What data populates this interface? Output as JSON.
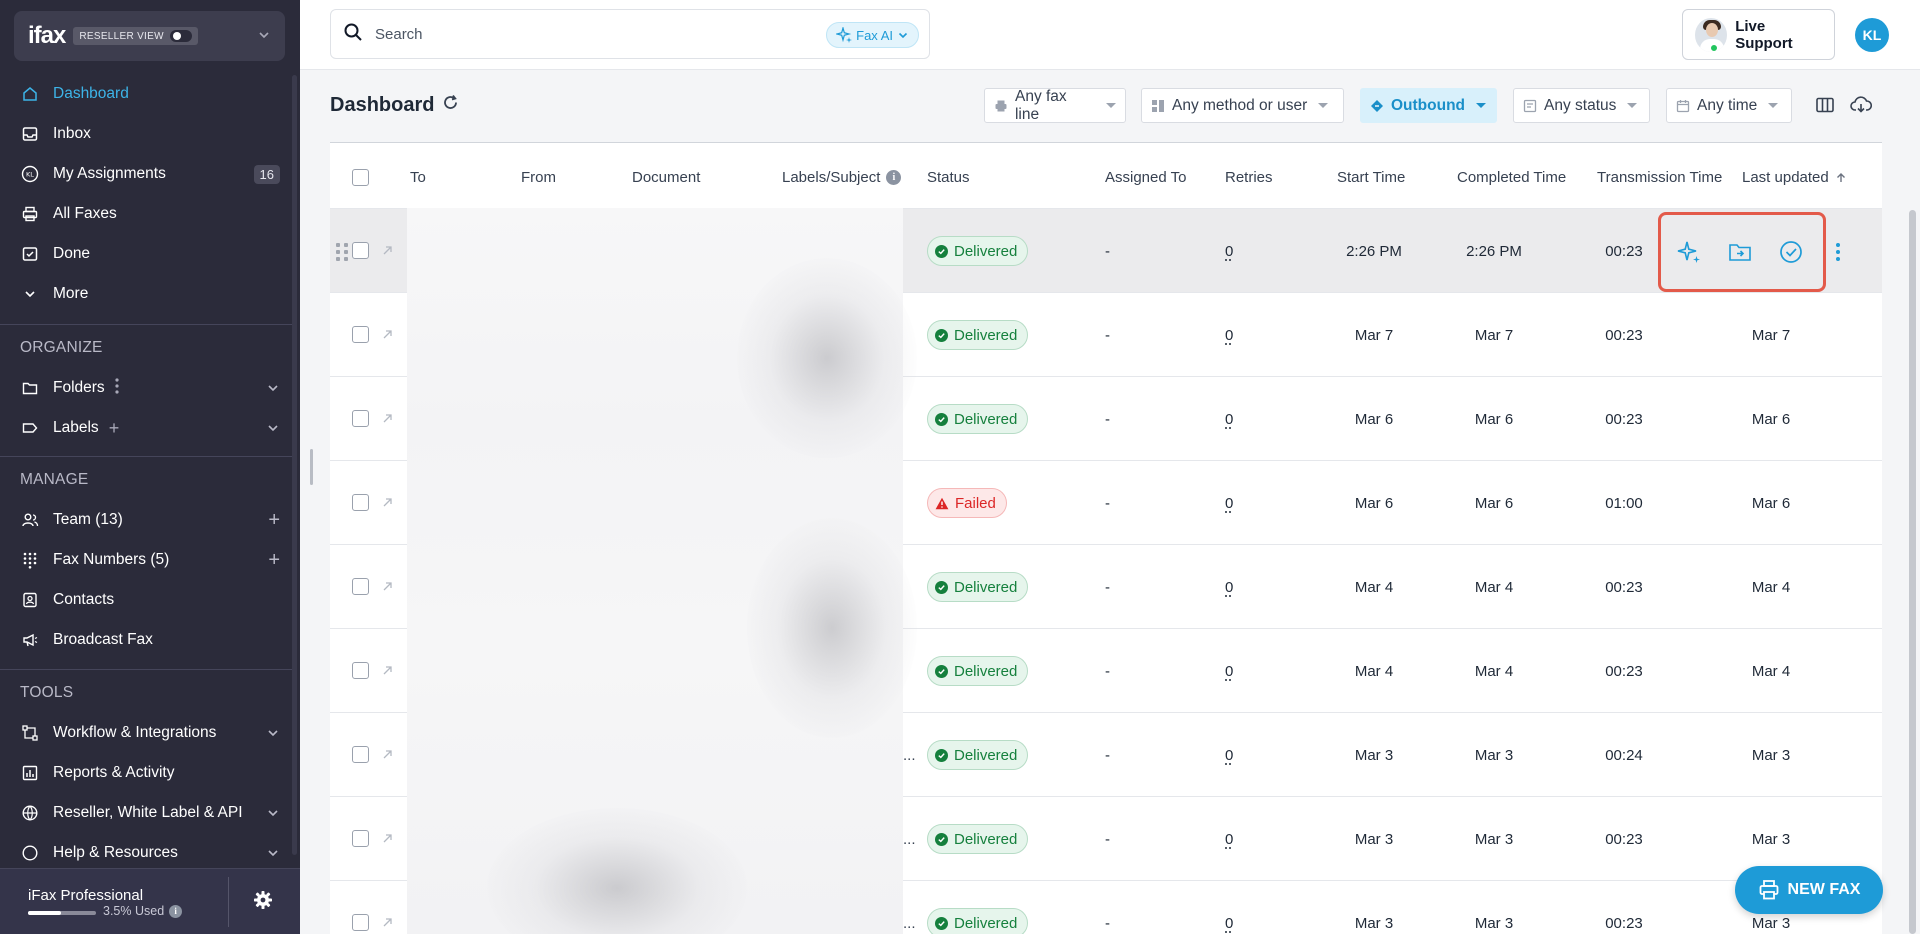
{
  "brand": {
    "logo": "ifax",
    "reseller_chip": "RESELLER VIEW"
  },
  "nav": {
    "dashboard": "Dashboard",
    "inbox": "Inbox",
    "my_assignments": "My Assignments",
    "my_assignments_count": "16",
    "all_faxes": "All Faxes",
    "done": "Done",
    "more": "More"
  },
  "organize": {
    "label": "ORGANIZE",
    "folders": "Folders",
    "labels": "Labels"
  },
  "manage": {
    "label": "MANAGE",
    "team": "Team (13)",
    "fax_numbers": "Fax Numbers (5)",
    "contacts": "Contacts",
    "broadcast": "Broadcast Fax"
  },
  "tools": {
    "label": "TOOLS",
    "workflow": "Workflow & Integrations",
    "reports": "Reports & Activity",
    "reseller": "Reseller, White Label & API",
    "help": "Help & Resources"
  },
  "plan": {
    "name": "iFax Professional",
    "used_label": "3.5% Used",
    "used_fraction": 0.035
  },
  "search": {
    "placeholder": "Search",
    "faxai_label": "Fax AI"
  },
  "live_support": {
    "label": "Live Support"
  },
  "user": {
    "initials": "KL"
  },
  "page": {
    "title": "Dashboard"
  },
  "filters": {
    "fax_line": "Any fax line",
    "method": "Any method or user",
    "direction": "Outbound",
    "status": "Any status",
    "time": "Any time"
  },
  "table": {
    "columns": {
      "to": "To",
      "from": "From",
      "document": "Document",
      "labels": "Labels/Subject",
      "status": "Status",
      "assigned": "Assigned To",
      "retries": "Retries",
      "start": "Start Time",
      "completed": "Completed Time",
      "transmission": "Transmission Time",
      "updated": "Last updated"
    },
    "rows": [
      {
        "truncated": "",
        "status": "Delivered",
        "assigned": "-",
        "retries": "0",
        "start": "2:26 PM",
        "completed": "2:26 PM",
        "transmission": "00:23",
        "updated": ""
      },
      {
        "truncated": "",
        "status": "Delivered",
        "assigned": "-",
        "retries": "0",
        "start": "Mar 7",
        "completed": "Mar 7",
        "transmission": "00:23",
        "updated": "Mar 7"
      },
      {
        "truncated": "",
        "status": "Delivered",
        "assigned": "-",
        "retries": "0",
        "start": "Mar 6",
        "completed": "Mar 6",
        "transmission": "00:23",
        "updated": "Mar 6"
      },
      {
        "truncated": "",
        "status": "Failed",
        "assigned": "-",
        "retries": "0",
        "start": "Mar 6",
        "completed": "Mar 6",
        "transmission": "01:00",
        "updated": "Mar 6"
      },
      {
        "truncated": "",
        "status": "Delivered",
        "assigned": "-",
        "retries": "0",
        "start": "Mar 4",
        "completed": "Mar 4",
        "transmission": "00:23",
        "updated": "Mar 4"
      },
      {
        "truncated": "",
        "status": "Delivered",
        "assigned": "-",
        "retries": "0",
        "start": "Mar 4",
        "completed": "Mar 4",
        "transmission": "00:23",
        "updated": "Mar 4"
      },
      {
        "truncated": "...",
        "status": "Delivered",
        "assigned": "-",
        "retries": "0",
        "start": "Mar 3",
        "completed": "Mar 3",
        "transmission": "00:24",
        "updated": "Mar 3"
      },
      {
        "truncated": "...",
        "status": "Delivered",
        "assigned": "-",
        "retries": "0",
        "start": "Mar 3",
        "completed": "Mar 3",
        "transmission": "00:23",
        "updated": "Mar 3"
      },
      {
        "truncated": "...",
        "status": "Delivered",
        "assigned": "-",
        "retries": "0",
        "start": "Mar 3",
        "completed": "Mar 3",
        "transmission": "00:23",
        "updated": "Mar 3"
      }
    ]
  },
  "new_fax": {
    "label": "NEW FAX"
  },
  "colors": {
    "accent": "#1e9bd7",
    "sidebar": "#2b2b3a",
    "delivered": "#15803d",
    "failed": "#dc2626",
    "highlight_box": "#e35a4a"
  }
}
